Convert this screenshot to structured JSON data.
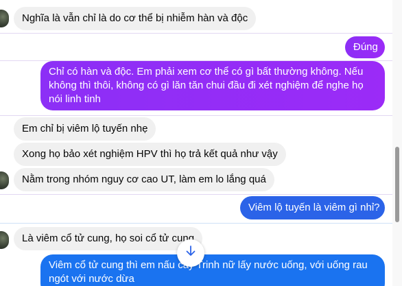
{
  "messages": [
    {
      "side": "in",
      "text": "Nghĩa là vẫn chỉ là do cơ thể bị nhiễm hàn và độc"
    },
    {
      "side": "out",
      "text": "Đúng"
    },
    {
      "side": "out",
      "text": "Chỉ có hàn và độc. Em phải xem cơ thể có gì bất thường không. Nếu không thì thôi, không có gì lăn tăn chui đầu đi xét nghiệm để nghe họ nói linh tinh"
    },
    {
      "side": "in",
      "text": "Em chỉ bị viêm lộ tuyến nhẹ"
    },
    {
      "side": "in",
      "text": "Xong họ bảo xét nghiệm HPV thì họ trả kết quả như vậy"
    },
    {
      "side": "in",
      "text": "Nằm trong nhóm nguy cơ cao UT, làm em lo lắng quá"
    },
    {
      "side": "out",
      "text": "Viêm lộ tuyến là viêm gì nhỉ?"
    },
    {
      "side": "in",
      "text": "Là viêm cổ tử cung, họ soi cổ tử cung"
    },
    {
      "side": "out",
      "text": "Viêm cổ tử cung thì em nấu cây Trinh nữ lấy nước uống, với uống rau ngót với nước dừa"
    }
  ],
  "icons": {
    "scroll_down": "arrow-down-icon",
    "avatar": "avatar"
  },
  "colors": {
    "incoming": "#f0f0f0",
    "outgoing_purple": "#8c2ff6",
    "outgoing_blue": "#2b63e8",
    "outgoing_blue_light": "#1a73f0"
  }
}
